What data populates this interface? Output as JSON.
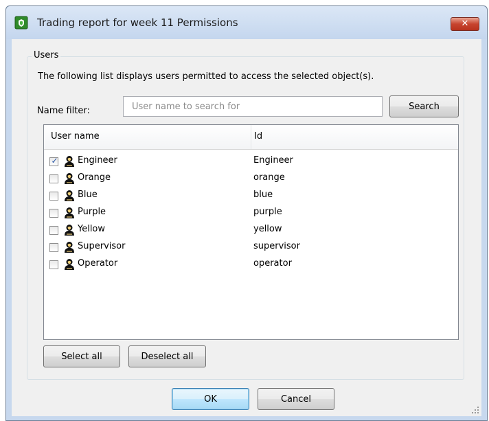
{
  "window": {
    "title": "Trading report for week 11 Permissions",
    "close_label": "✕"
  },
  "group": {
    "label": "Users",
    "description": "The following list displays users permitted to access the selected object(s)."
  },
  "filter": {
    "label": "Name filter:",
    "value": "",
    "placeholder": "User name to search for",
    "search_label": "Search"
  },
  "list": {
    "columns": [
      "User name",
      "Id"
    ],
    "rows": [
      {
        "name": "Engineer",
        "id": "Engineer",
        "checked": true
      },
      {
        "name": "Orange",
        "id": "orange",
        "checked": false
      },
      {
        "name": "Blue",
        "id": "blue",
        "checked": false
      },
      {
        "name": "Purple",
        "id": "purple",
        "checked": false
      },
      {
        "name": "Yellow",
        "id": "yellow",
        "checked": false
      },
      {
        "name": "Supervisor",
        "id": "supervisor",
        "checked": false
      },
      {
        "name": "Operator",
        "id": "operator",
        "checked": false
      }
    ]
  },
  "buttons": {
    "select_all": "Select all",
    "deselect_all": "Deselect all",
    "ok": "OK",
    "cancel": "Cancel"
  },
  "icons": {
    "app": "green-shield-icon",
    "user": "user-silhouette-icon",
    "check": "checkmark-icon",
    "grip": "resize-grip-icon"
  },
  "colors": {
    "titlebar": "#c4d6ee",
    "close_button": "#c7442f",
    "client_background": "#f0f0f0",
    "default_button_border": "#3c7fb1",
    "checkmark": "#2d5aa8"
  }
}
